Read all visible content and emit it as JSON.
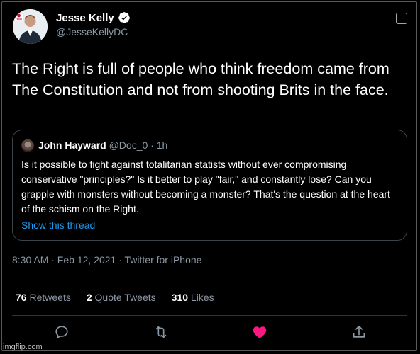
{
  "author": {
    "display_name": "Jesse Kelly",
    "handle": "@JesseKellyDC",
    "avatar_badge": "FIRST"
  },
  "tweet": {
    "text": "The Right is full of people who think freedom came from The Constitution and not from shooting Brits in the face.",
    "timestamp": "8:30 AM · Feb 12, 2021 · Twitter for iPhone"
  },
  "quote": {
    "display_name": "John Hayward",
    "handle_time": "@Doc_0 · 1h",
    "text": "Is it possible to fight against totalitarian statists without ever compromising conservative \"principles?\" Is it better to play \"fair,\" and constantly lose? Can you grapple with monsters without becoming a monster? That's the question at the heart of the schism on the Right.",
    "link": "Show this thread"
  },
  "stats": {
    "retweets_count": "76",
    "retweets_label": "Retweets",
    "quotes_count": "2",
    "quotes_label": "Quote Tweets",
    "likes_count": "310",
    "likes_label": "Likes"
  },
  "watermark": "imgflip.com",
  "colors": {
    "background": "#000000",
    "secondary_text": "#8b98a5",
    "link": "#1d9bf0",
    "like": "#f91880",
    "verified": "#ffffff"
  }
}
